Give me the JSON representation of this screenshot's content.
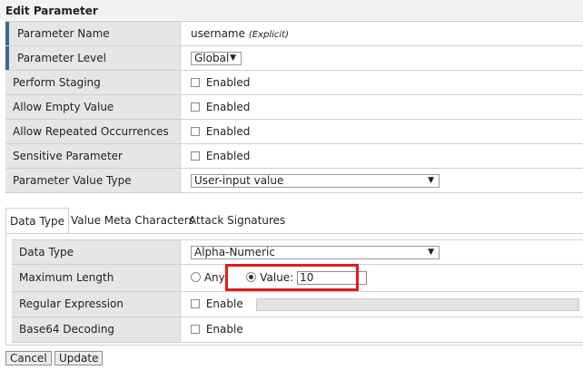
{
  "page": {
    "title": "Edit Parameter"
  },
  "params": {
    "name_label": "Parameter Name",
    "name_value": "username",
    "name_note": "(Explicit)",
    "level_label": "Parameter Level",
    "level_value": "Global",
    "staging_label": "Perform Staging",
    "staging_value": "Enabled",
    "empty_label": "Allow Empty Value",
    "empty_value": "Enabled",
    "repeated_label": "Allow Repeated Occurrences",
    "repeated_value": "Enabled",
    "sensitive_label": "Sensitive Parameter",
    "sensitive_value": "Enabled",
    "valtype_label": "Parameter Value Type",
    "valtype_value": "User-input value"
  },
  "tabs": [
    {
      "label": "Data Type"
    },
    {
      "label": "Value Meta Characters"
    },
    {
      "label": "Attack Signatures"
    }
  ],
  "datatype": {
    "type_label": "Data Type",
    "type_value": "Alpha-Numeric",
    "maxlen_label": "Maximum Length",
    "any_label": "Any",
    "value_label": "Value:",
    "value_input": "10",
    "regex_label": "Regular Expression",
    "regex_enable": "Enable",
    "b64_label": "Base64 Decoding",
    "b64_enable": "Enable"
  },
  "buttons": {
    "cancel": "Cancel",
    "update": "Update"
  },
  "colors": {
    "highlight": "#e21a1a",
    "required_bar": "#3b6a8f"
  },
  "icons": {
    "dropdown": "chevron-down-icon"
  }
}
